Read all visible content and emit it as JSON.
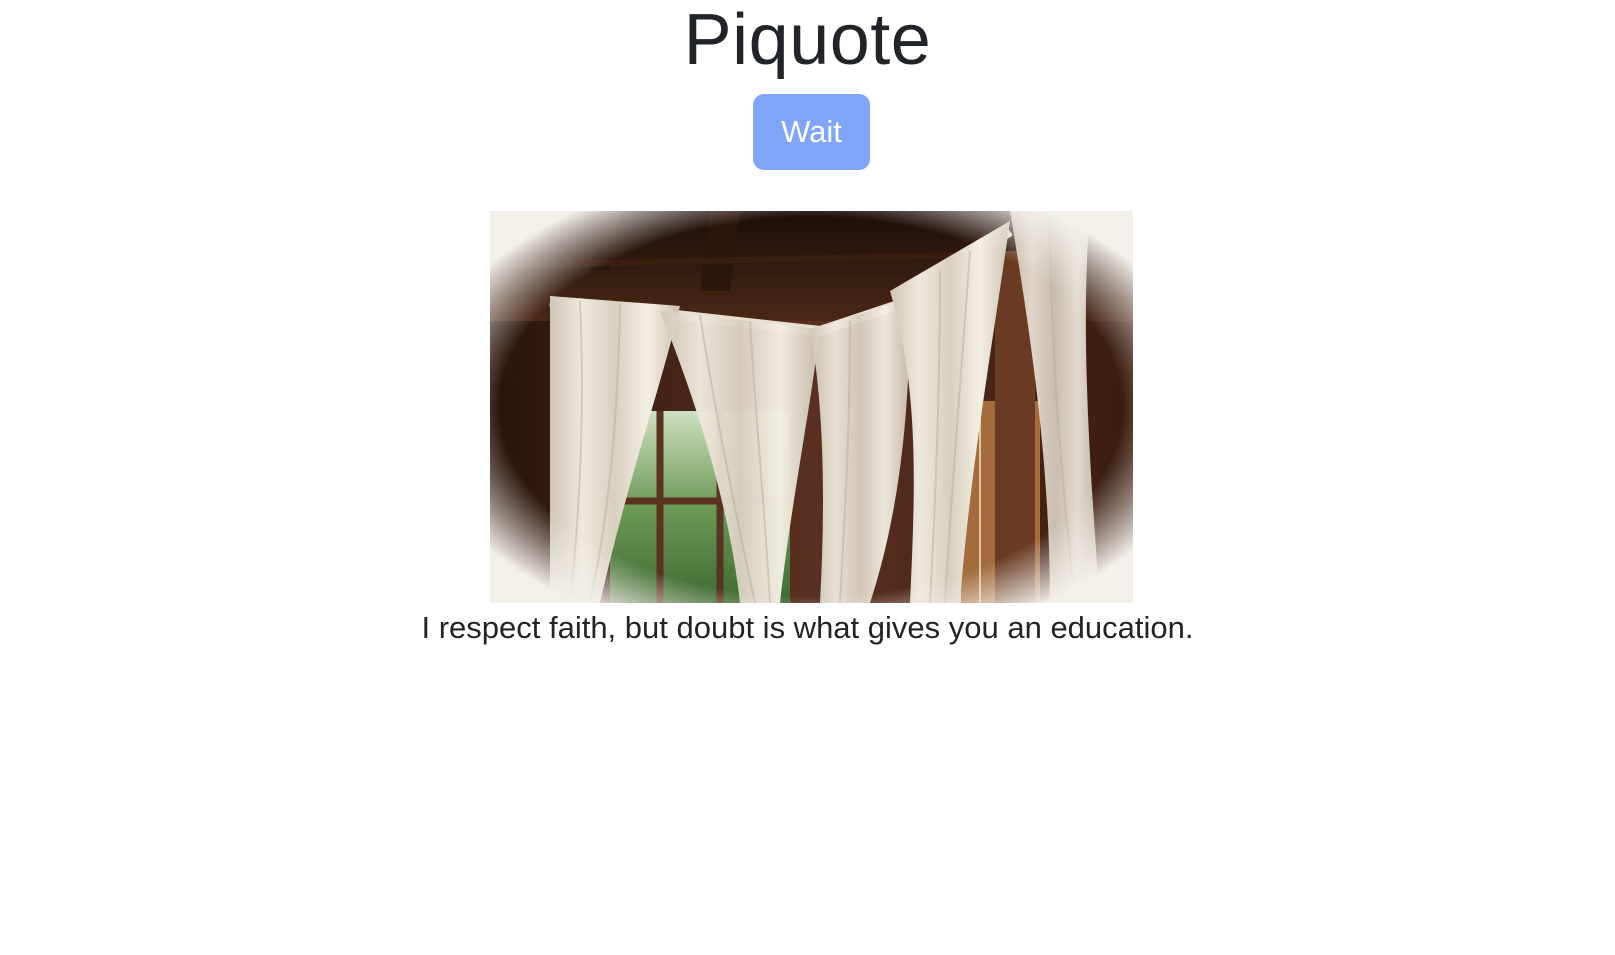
{
  "header": {
    "title": "Piquote"
  },
  "controls": {
    "wait_label": "Wait",
    "wait_color": "#7fa4f8"
  },
  "photo": {
    "subject": "window-curtains-photo"
  },
  "quote": {
    "text": "I respect faith, but doubt is what gives you an education."
  },
  "colors": {
    "text": "#212529",
    "background": "#ffffff"
  }
}
